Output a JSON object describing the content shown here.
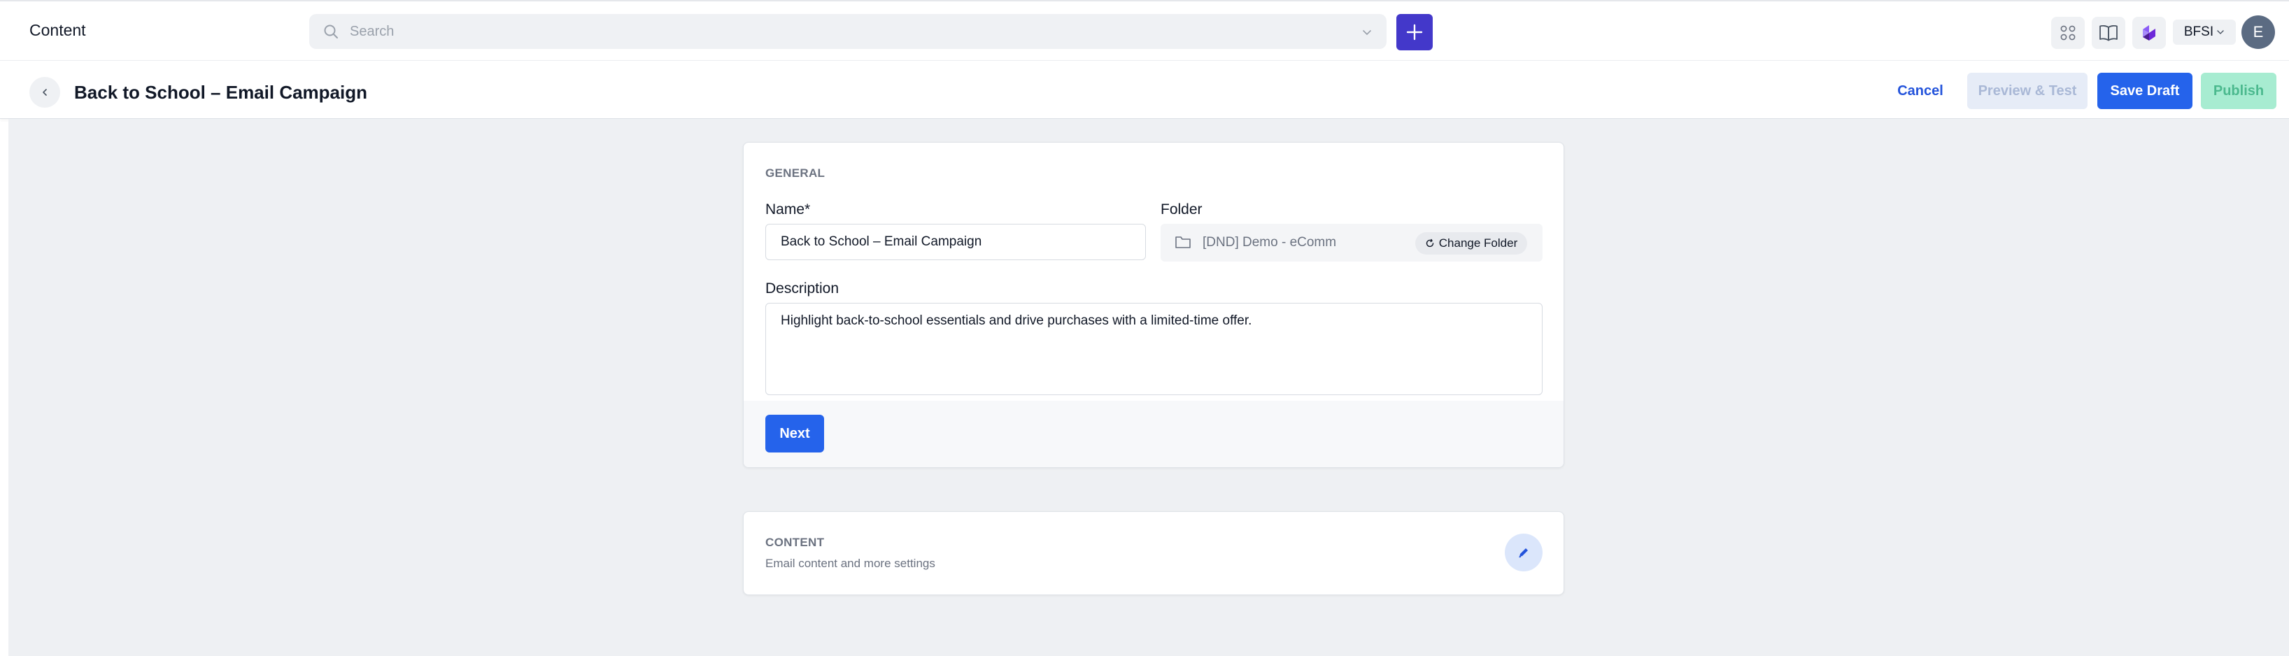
{
  "topbar": {
    "app_title": "Content",
    "search_placeholder": "Search",
    "org_name": "BFSI",
    "avatar_initial": "E"
  },
  "icons": {
    "search": "search-icon",
    "dropdown": "chevron-down-icon",
    "add": "plus-icon",
    "apps": "grid-icon",
    "docs": "book-icon",
    "assistant": "sparkle-icon",
    "back": "chevron-left-icon",
    "folder": "folder-icon",
    "refresh": "refresh-icon",
    "edit": "pencil-icon"
  },
  "header": {
    "title": "Back to School – Email Campaign",
    "cancel_label": "Cancel",
    "preview_label": "Preview & Test",
    "save_label": "Save Draft",
    "publish_label": "Publish"
  },
  "general": {
    "section_title": "GENERAL",
    "name_label": "Name*",
    "name_value": "Back to School – Email Campaign",
    "folder_label": "Folder",
    "folder_value": "[DND] Demo - eComm",
    "change_folder_label": "Change Folder",
    "description_label": "Description",
    "description_value": "Highlight back-to-school essentials and drive purchases with a limited-time offer.",
    "next_label": "Next"
  },
  "content_section": {
    "title": "CONTENT",
    "subtitle": "Email content and more settings"
  },
  "colors": {
    "primary": "#2563eb",
    "add_button": "#4338ca",
    "publish_disabled": "#a7ecd1",
    "preview_disabled": "#e6ecf7",
    "canvas": "#eef0f3"
  }
}
